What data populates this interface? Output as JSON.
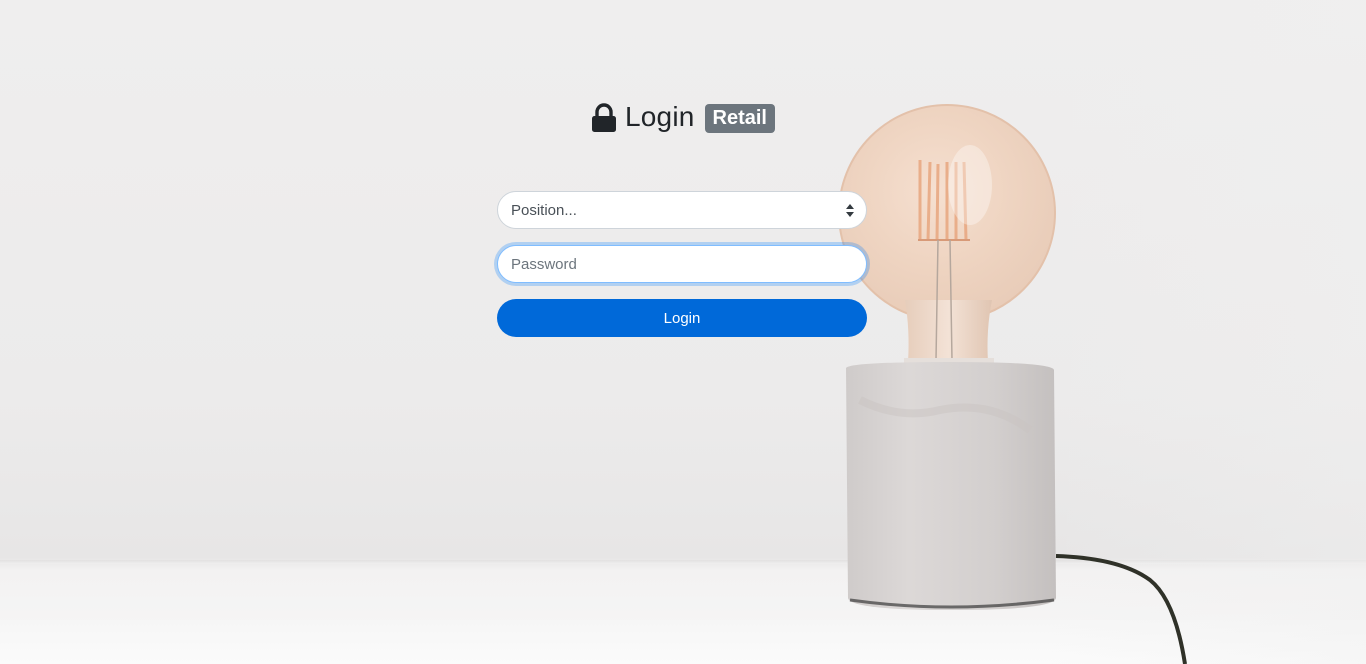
{
  "header": {
    "title": "Login",
    "badge": "Retail",
    "icon": "lock-icon"
  },
  "form": {
    "position_select": {
      "selected": "Position..."
    },
    "password": {
      "value": "",
      "placeholder": "Password"
    },
    "login_button": "Login"
  },
  "colors": {
    "primary": "#0069d9",
    "badge": "#6c757d",
    "focus_border": "#80bdff"
  }
}
